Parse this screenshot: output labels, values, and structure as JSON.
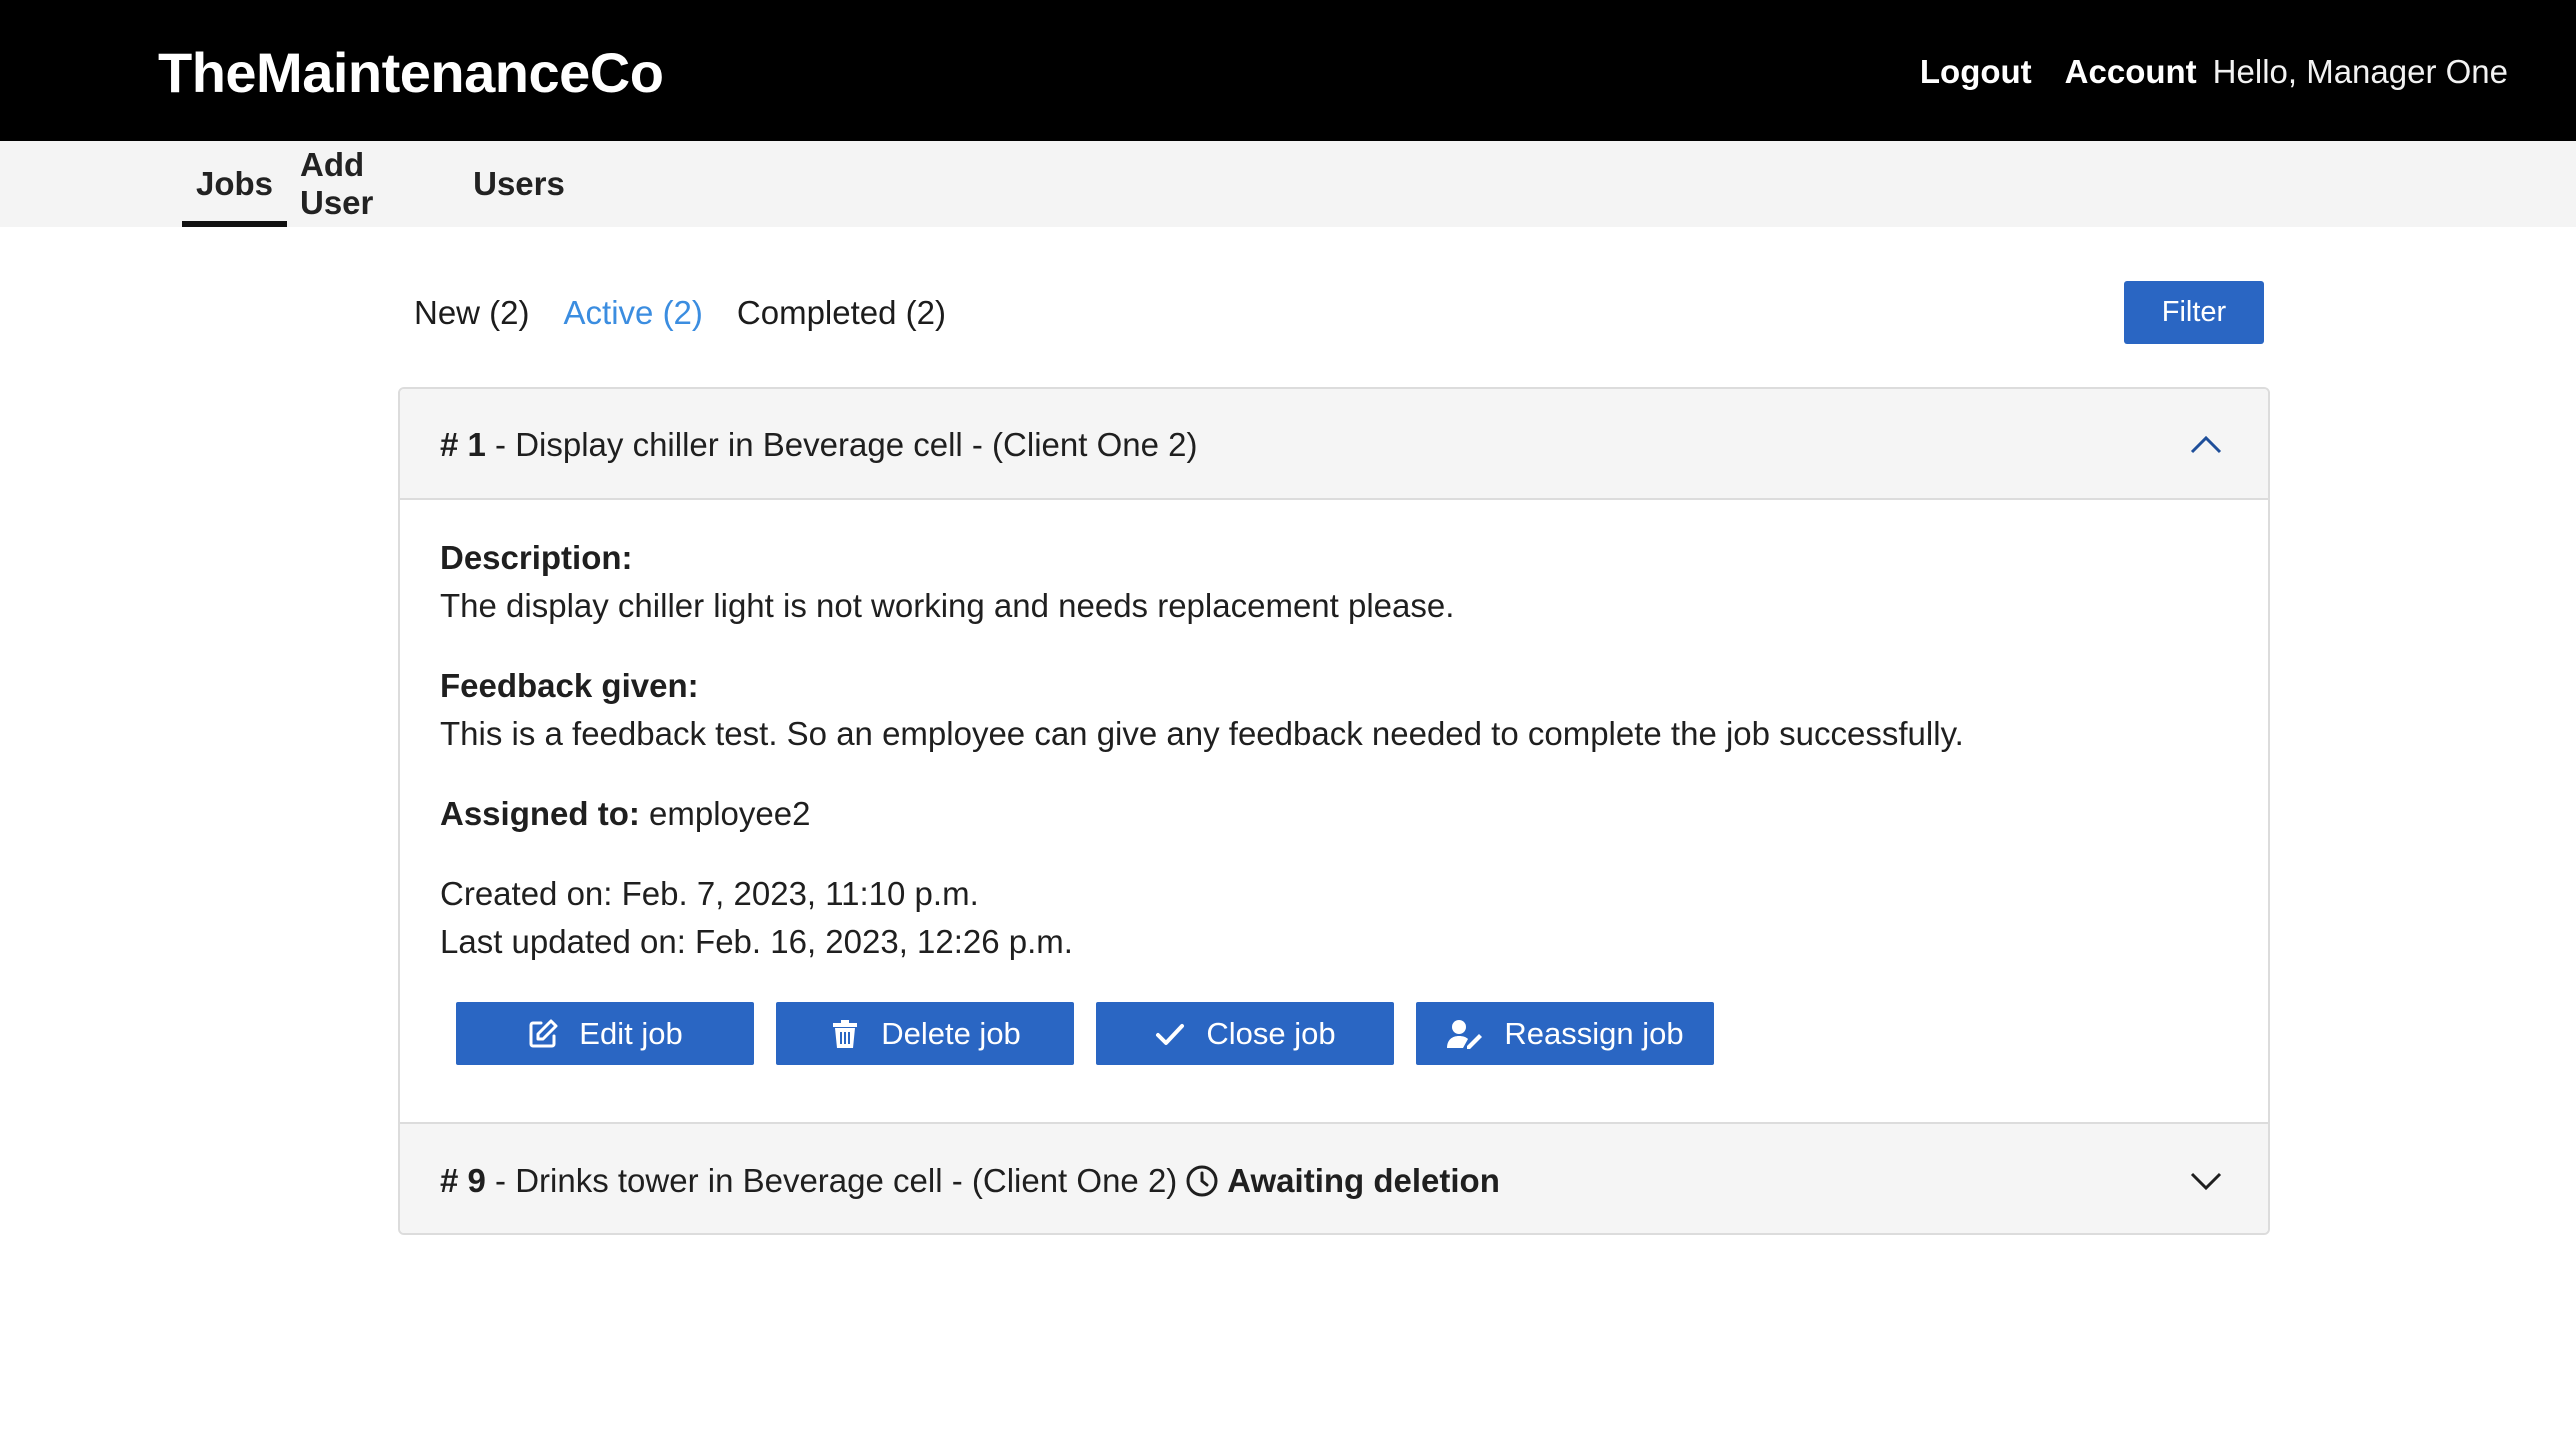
{
  "header": {
    "brand": "TheMaintenanceCo",
    "logout": "Logout",
    "account": "Account",
    "greeting": "Hello, Manager One"
  },
  "nav": {
    "tabs": [
      {
        "label": "Jobs",
        "active": true
      },
      {
        "label": "Add User",
        "active": false
      },
      {
        "label": "Users",
        "active": false
      }
    ]
  },
  "status_tabs": [
    {
      "label": "New (2)",
      "active": false
    },
    {
      "label": "Active (2)",
      "active": true
    },
    {
      "label": "Completed (2)",
      "active": false
    }
  ],
  "filter_label": "Filter",
  "jobs": [
    {
      "number": "# 1",
      "title": " - Display chiller in Beverage cell - (Client One 2)",
      "expanded": true,
      "description_label": "Description:",
      "description": "The display chiller light is not working and needs replacement please.",
      "feedback_label": "Feedback given:",
      "feedback": "This is a feedback test. So an employee can give any feedback needed to complete the job successfully.",
      "assigned_label": "Assigned to:",
      "assigned_to": " employee2",
      "created": "Created on: Feb. 7, 2023, 11:10 p.m.",
      "updated": "Last updated on: Feb. 16, 2023, 12:26 p.m.",
      "actions": {
        "edit": "Edit job",
        "delete": "Delete job",
        "close": "Close job",
        "reassign": "Reassign job"
      }
    },
    {
      "number": "# 9",
      "title": " - Drinks tower in Beverage cell - (Client One 2)",
      "status": "Awaiting deletion",
      "expanded": false
    }
  ],
  "colors": {
    "topbar": "#000000",
    "primary": "#2a66c3",
    "active_tab": "#3b8de0",
    "subnav_bg": "#f4f4f4"
  }
}
